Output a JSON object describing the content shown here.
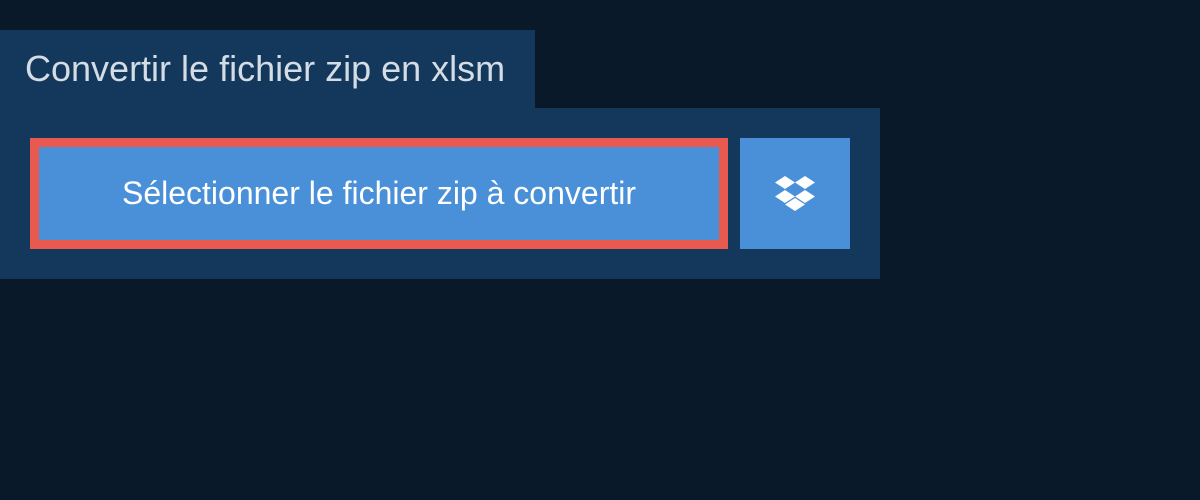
{
  "header": {
    "title": "Convertir le fichier zip en xlsm"
  },
  "actions": {
    "select_file_label": "Sélectionner le fichier zip à convertir"
  }
}
